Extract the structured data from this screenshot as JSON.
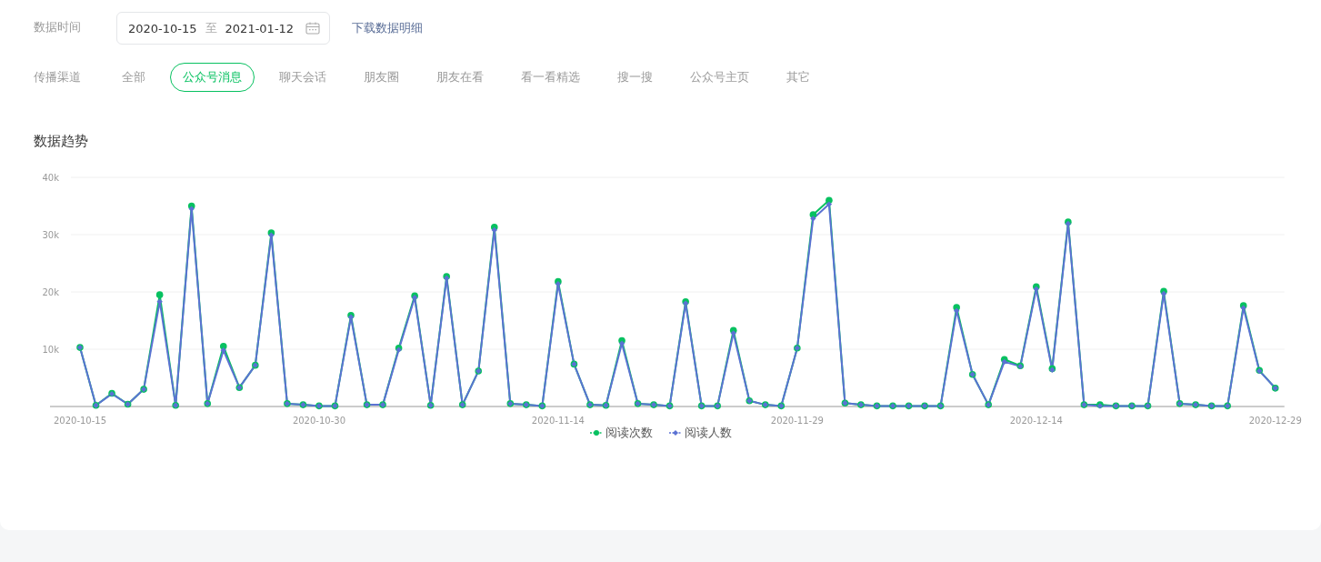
{
  "filters": {
    "date": {
      "label": "数据时间",
      "start": "2020-10-15",
      "separator": "至",
      "end": "2021-01-12",
      "download_link": "下载数据明细"
    },
    "channel": {
      "label": "传播渠道",
      "tabs": [
        {
          "label": "全部",
          "selected": false
        },
        {
          "label": "公众号消息",
          "selected": true
        },
        {
          "label": "聊天会话",
          "selected": false
        },
        {
          "label": "朋友圈",
          "selected": false
        },
        {
          "label": "朋友在看",
          "selected": false
        },
        {
          "label": "看一看精选",
          "selected": false
        },
        {
          "label": "搜一搜",
          "selected": false
        },
        {
          "label": "公众号主页",
          "selected": false
        },
        {
          "label": "其它",
          "selected": false
        }
      ]
    }
  },
  "trend": {
    "chart_data": {
      "type": "line",
      "title": "数据趋势",
      "grid": true,
      "categories": [
        "2020-10-15",
        null,
        null,
        null,
        null,
        null,
        null,
        null,
        null,
        null,
        null,
        null,
        null,
        null,
        null,
        "2020-10-30",
        null,
        null,
        null,
        null,
        null,
        null,
        null,
        null,
        null,
        null,
        null,
        null,
        null,
        null,
        "2020-11-14",
        null,
        null,
        null,
        null,
        null,
        null,
        null,
        null,
        null,
        null,
        null,
        null,
        null,
        null,
        "2020-11-29",
        null,
        null,
        null,
        null,
        null,
        null,
        null,
        null,
        null,
        null,
        null,
        null,
        null,
        null,
        "2020-12-14",
        null,
        null,
        null,
        null,
        null,
        null,
        null,
        null,
        null,
        null,
        null,
        null,
        null,
        null,
        "2020-12-29"
      ],
      "series": [
        {
          "name": "阅读次数",
          "color": "#07c160",
          "marker": "circle",
          "values": [
            10300,
            200,
            2300,
            400,
            3000,
            19500,
            200,
            35000,
            500,
            10500,
            3300,
            7200,
            30300,
            500,
            300,
            100,
            100,
            15900,
            300,
            300,
            10200,
            19300,
            200,
            22700,
            300,
            6200,
            31300,
            500,
            300,
            100,
            21800,
            7400,
            300,
            200,
            11500,
            500,
            300,
            100,
            18300,
            100,
            100,
            13300,
            1000,
            300,
            100,
            10200,
            33500,
            36000,
            600,
            300,
            100,
            100,
            100,
            100,
            100,
            17300,
            5600,
            300,
            8200,
            7100,
            20900,
            6600,
            32200,
            300,
            300,
            100,
            100,
            100,
            20100,
            500,
            300,
            100,
            100,
            17600,
            6300,
            3200
          ]
        },
        {
          "name": "阅读人数",
          "color": "#5b72d3",
          "marker": "diamond",
          "values": [
            10300,
            200,
            2200,
            400,
            3000,
            18300,
            200,
            34500,
            500,
            9800,
            3300,
            7200,
            29900,
            500,
            300,
            100,
            100,
            15600,
            300,
            300,
            9900,
            19000,
            200,
            22400,
            300,
            6200,
            30800,
            500,
            300,
            100,
            21400,
            7400,
            300,
            200,
            11000,
            500,
            300,
            100,
            18000,
            100,
            100,
            12800,
            1000,
            300,
            100,
            10200,
            32800,
            35300,
            600,
            300,
            100,
            100,
            100,
            100,
            100,
            16700,
            5600,
            300,
            7800,
            7000,
            20500,
            6400,
            31900,
            300,
            100,
            100,
            100,
            100,
            19700,
            500,
            300,
            100,
            100,
            17200,
            6200,
            3200
          ]
        }
      ],
      "ylim": [
        0,
        40000
      ],
      "yticks": [
        {
          "value": 10000,
          "label": "10k"
        },
        {
          "value": 20000,
          "label": "20k"
        },
        {
          "value": 30000,
          "label": "30k"
        },
        {
          "value": 40000,
          "label": "40k"
        }
      ]
    }
  }
}
